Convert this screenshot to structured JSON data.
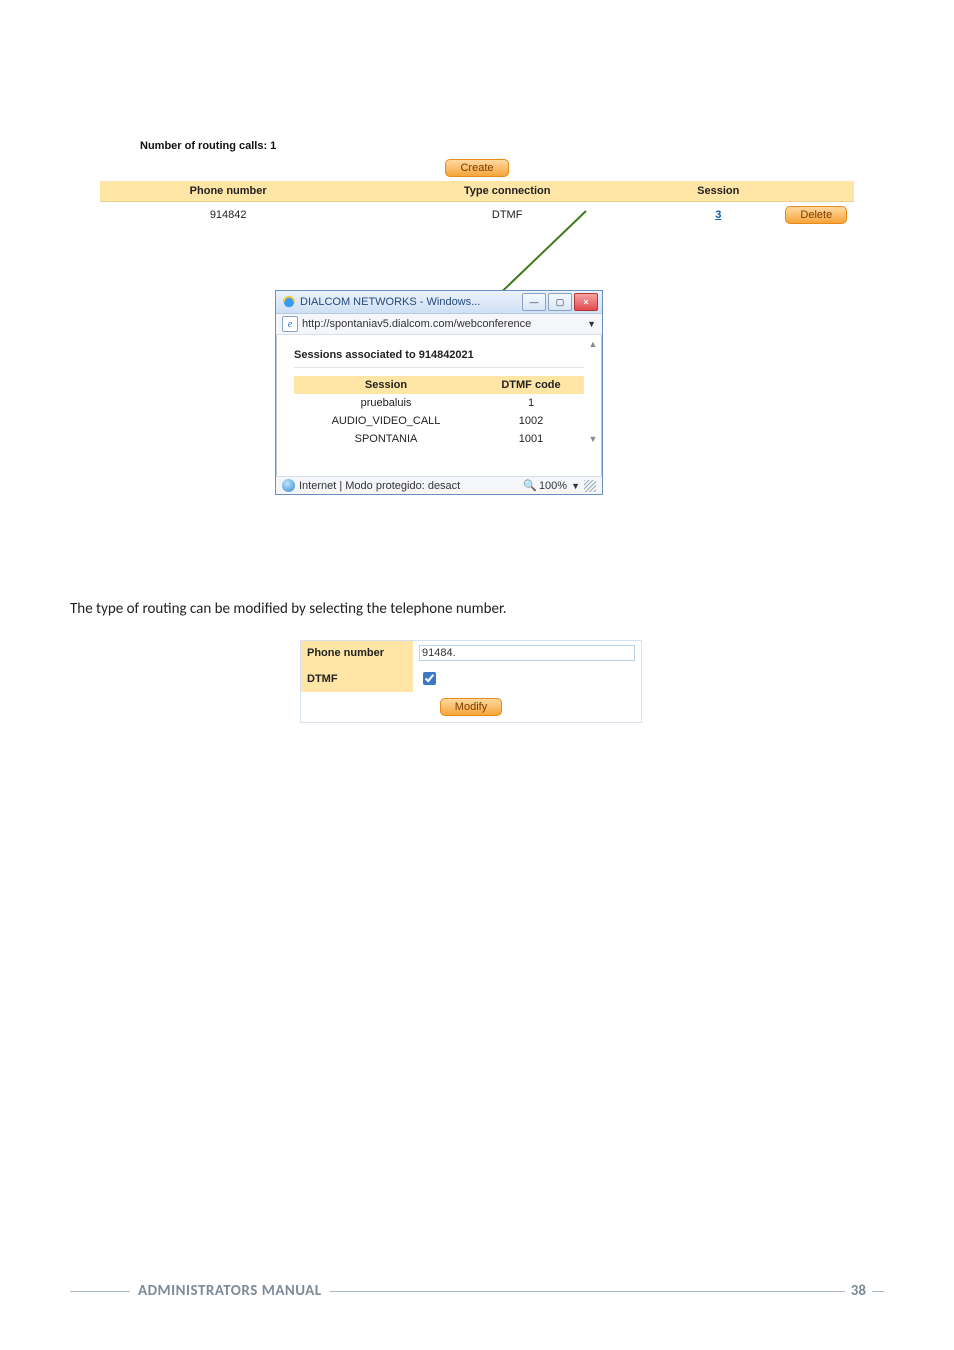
{
  "routing": {
    "count_label": "Number of routing calls:  1",
    "create_label": "Create",
    "headers": {
      "phone": "Phone number",
      "type": "Type connection",
      "session": "Session"
    },
    "row": {
      "phone": "914842",
      "type": "DTMF",
      "session": "3"
    },
    "delete_label": "Delete"
  },
  "popup": {
    "title": "DIALCOM NETWORKS - Windows...",
    "url": "http://spontaniav5.dialcom.com/webconference",
    "heading": "Sessions associated to 914842021",
    "columns": {
      "session": "Session",
      "dtmf": "DTMF code"
    },
    "rows": [
      {
        "session": "pruebaluis",
        "dtmf": "1"
      },
      {
        "session": "AUDIO_VIDEO_CALL",
        "dtmf": "1002"
      },
      {
        "session": "SPONTANIA",
        "dtmf": "1001"
      }
    ],
    "status_text": "Internet | Modo protegido: desact",
    "zoom": "100%"
  },
  "body_text": "The type of routing can be modified by selecting the telephone number.",
  "modify_form": {
    "phone_label": "Phone number",
    "phone_value": "91484.",
    "dtmf_label": "DTMF",
    "dtmf_checked": true,
    "modify_label": "Modify"
  },
  "footer": {
    "title": "ADMINISTRATORS MANUAL",
    "page": "38"
  }
}
